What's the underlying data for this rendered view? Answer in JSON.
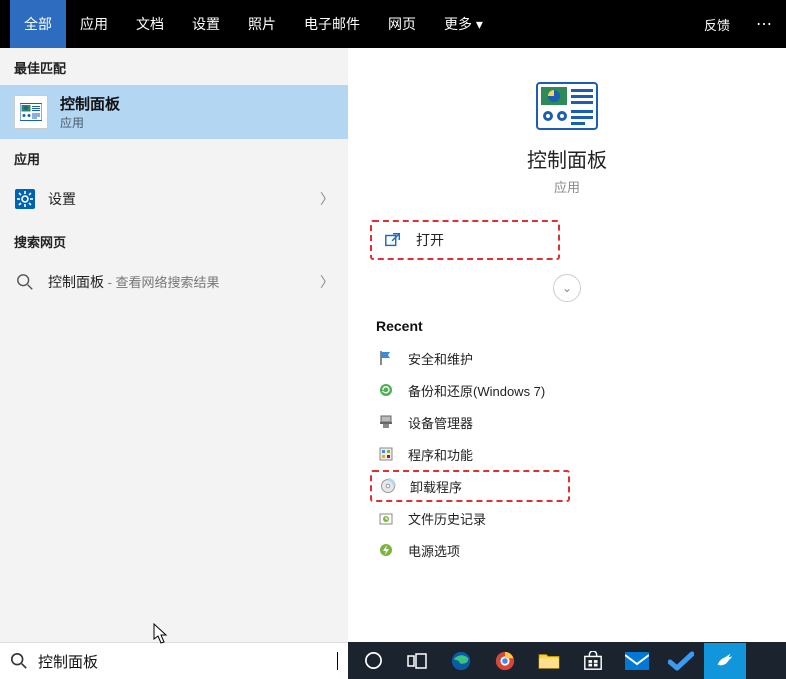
{
  "tabs": {
    "items": [
      "全部",
      "应用",
      "文档",
      "设置",
      "照片",
      "电子邮件",
      "网页",
      "更多 ▾"
    ],
    "active_index": 0,
    "feedback": "反馈"
  },
  "sections": {
    "best_match": "最佳匹配",
    "apps": "应用",
    "web": "搜索网页"
  },
  "best_match": {
    "title": "控制面板",
    "subtitle": "应用"
  },
  "app_row": {
    "label": "设置"
  },
  "web_row": {
    "label": "控制面板",
    "suffix": " - 查看网络搜索结果"
  },
  "right": {
    "title": "控制面板",
    "subtitle": "应用",
    "open_label": "打开",
    "recent_header": "Recent",
    "recent": [
      {
        "label": "安全和维护",
        "icon": "flag"
      },
      {
        "label": "备份和还原(Windows 7)",
        "icon": "backup"
      },
      {
        "label": "设备管理器",
        "icon": "device"
      },
      {
        "label": "程序和功能",
        "icon": "programs"
      },
      {
        "label": "卸载程序",
        "icon": "cd",
        "highlighted": true
      },
      {
        "label": "文件历史记录",
        "icon": "filehistory"
      },
      {
        "label": "电源选项",
        "icon": "power"
      }
    ]
  },
  "search": {
    "value": "控制面板"
  }
}
